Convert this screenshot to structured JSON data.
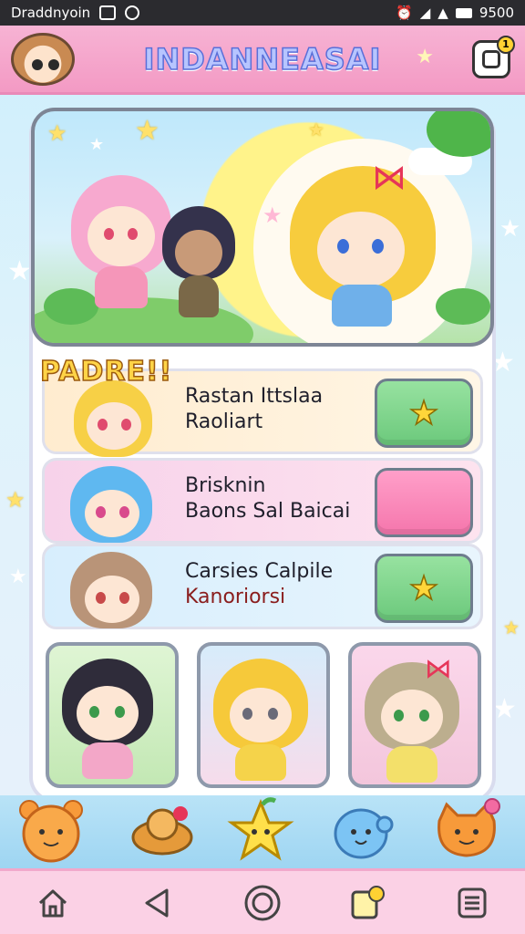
{
  "status_bar": {
    "carrier": "Draddnyoin",
    "time": "9500"
  },
  "header": {
    "title": "INDANNEASAI",
    "notification_count": "1"
  },
  "list": {
    "section_title": "PADRE!!",
    "items": [
      {
        "line1": "Rastan Ittslaa",
        "line2": "Raoliart",
        "button": "star-button",
        "button_color": "#7fd58c"
      },
      {
        "line1": "Brisknin",
        "line2": "Baons Sal Baicai",
        "button": "blank-button",
        "button_color": "#f78ab8"
      },
      {
        "line1": "Carsies Calpile",
        "line2": "Kanoriorsi",
        "button": "star-button",
        "button_color": "#7fd58c"
      }
    ]
  },
  "gallery": {
    "cards": [
      {
        "name": "black-hair-girl-card"
      },
      {
        "name": "blonde-bear-girl-card"
      },
      {
        "name": "brown-bow-girl-card"
      }
    ]
  },
  "mascots": [
    "orange-bear-mascot",
    "spinning-top-mascot",
    "yellow-star-mascot",
    "blue-blob-mascot",
    "orange-cat-mascot"
  ],
  "nav": [
    "home-icon",
    "back-icon",
    "circle-icon",
    "chat-icon",
    "menu-icon"
  ],
  "colors": {
    "header_pink": "#f5a6cc",
    "accent_green": "#7fd58c",
    "accent_pink": "#f78ab8",
    "title_blue": "#5a6fd8"
  }
}
